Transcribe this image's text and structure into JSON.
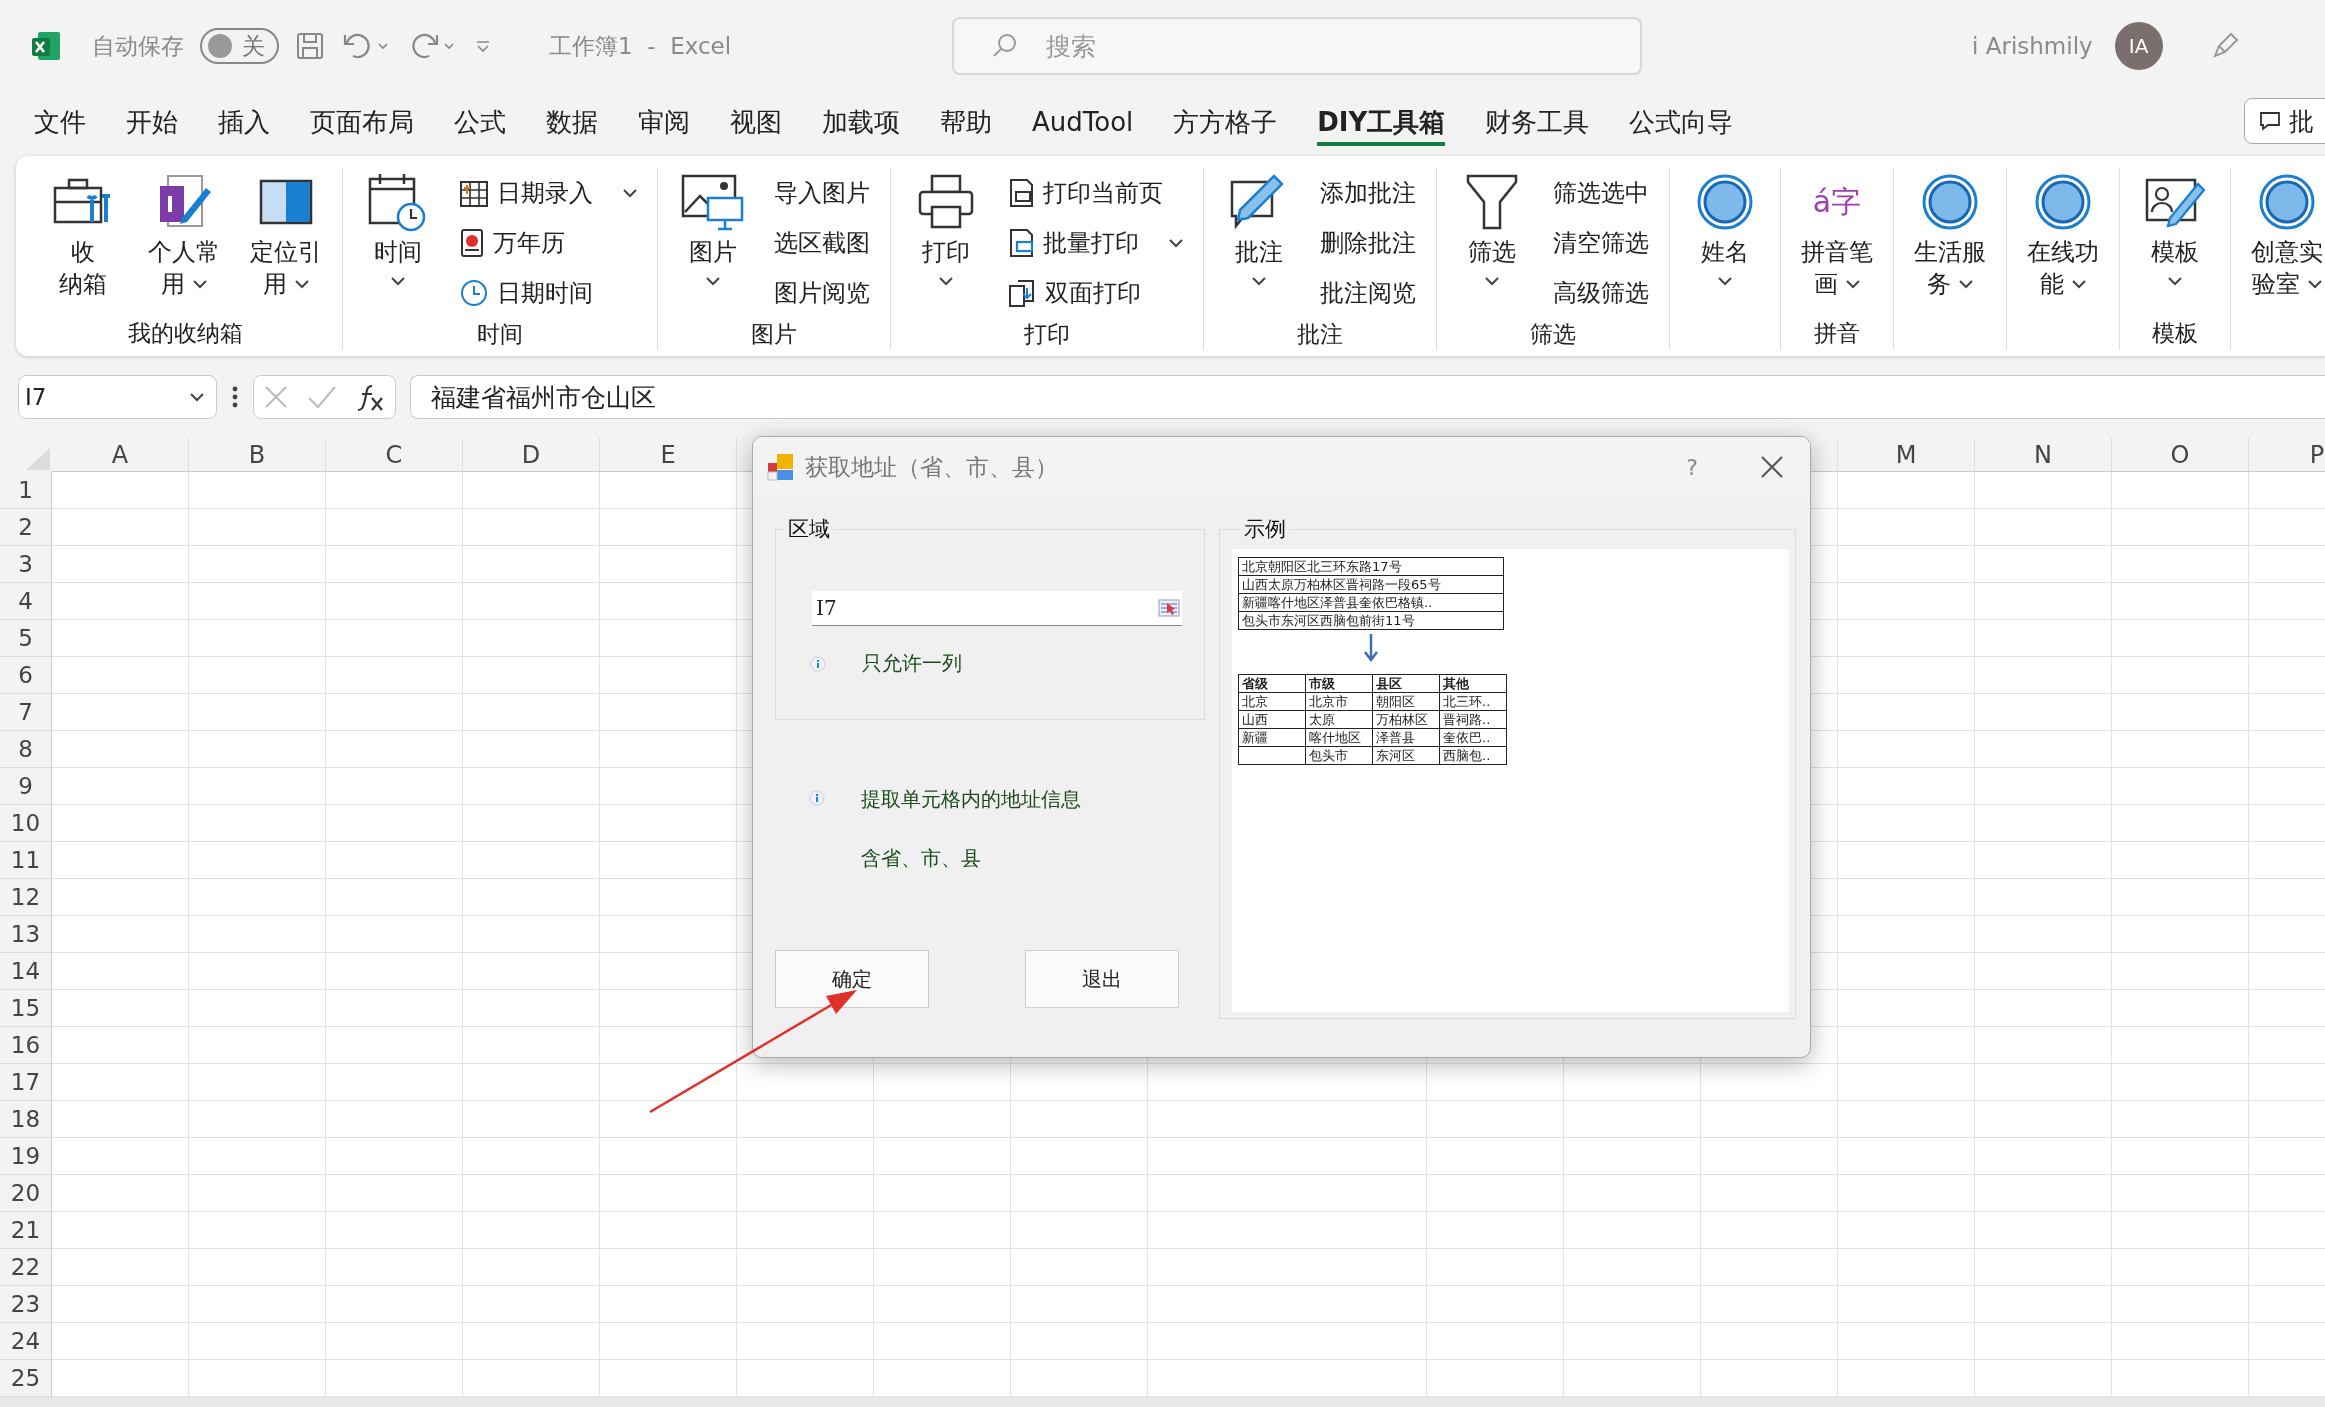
{
  "title_bar": {
    "autosave_label": "自动保存",
    "autosave_toggle": {
      "label": "关",
      "on": false
    },
    "document_title": "工作簿1  -  Excel",
    "search": {
      "placeholder": "搜索"
    },
    "user_name": "i Arishmily",
    "avatar_initials": "IA"
  },
  "ribbon_tabs": [
    {
      "label": "文件",
      "selected": false
    },
    {
      "label": "开始",
      "selected": false
    },
    {
      "label": "插入",
      "selected": false
    },
    {
      "label": "页面布局",
      "selected": false
    },
    {
      "label": "公式",
      "selected": false
    },
    {
      "label": "数据",
      "selected": false
    },
    {
      "label": "审阅",
      "selected": false
    },
    {
      "label": "视图",
      "selected": false
    },
    {
      "label": "加载项",
      "selected": false
    },
    {
      "label": "帮助",
      "selected": false
    },
    {
      "label": "AudTool",
      "selected": false
    },
    {
      "label": "方方格子",
      "selected": false
    },
    {
      "label": "DIY工具箱",
      "selected": true
    },
    {
      "label": "财务工具",
      "selected": false
    },
    {
      "label": "公式向导",
      "selected": false
    }
  ],
  "comment_button": {
    "label": "批"
  },
  "ribbon_groups": [
    {
      "label": "我的收纳箱",
      "controls": [
        {
          "kind": "large",
          "lines": [
            "收",
            "纳箱"
          ],
          "dropdown": false
        },
        {
          "kind": "large",
          "lines": [
            "个人常",
            "用"
          ],
          "dropdown": true
        },
        {
          "kind": "large",
          "lines": [
            "定位引",
            "用"
          ],
          "dropdown": true
        }
      ]
    },
    {
      "label": "时间",
      "controls": [
        {
          "kind": "large",
          "lines": [
            "时间"
          ],
          "dropdown": true
        },
        {
          "kind": "small",
          "lines": [
            "日期录入"
          ],
          "dropdown": true
        },
        {
          "kind": "small",
          "lines": [
            "万年历"
          ],
          "dropdown": false
        },
        {
          "kind": "small",
          "lines": [
            "日期时间"
          ],
          "dropdown": false
        }
      ]
    },
    {
      "label": "图片",
      "controls": [
        {
          "kind": "large",
          "lines": [
            "图片"
          ],
          "dropdown": true
        },
        {
          "kind": "small",
          "lines": [
            "导入图片"
          ],
          "dropdown": false
        },
        {
          "kind": "small",
          "lines": [
            "选区截图"
          ],
          "dropdown": false
        },
        {
          "kind": "small",
          "lines": [
            "图片阅览"
          ],
          "dropdown": false
        }
      ]
    },
    {
      "label": "打印",
      "controls": [
        {
          "kind": "large",
          "lines": [
            "打印"
          ],
          "dropdown": true
        },
        {
          "kind": "small",
          "lines": [
            "打印当前页"
          ],
          "dropdown": false
        },
        {
          "kind": "small",
          "lines": [
            "批量打印"
          ],
          "dropdown": true
        },
        {
          "kind": "small",
          "lines": [
            "双面打印"
          ],
          "dropdown": false
        }
      ]
    },
    {
      "label": "批注",
      "controls": [
        {
          "kind": "large",
          "lines": [
            "批注"
          ],
          "dropdown": true
        },
        {
          "kind": "small",
          "lines": [
            "添加批注"
          ],
          "dropdown": false
        },
        {
          "kind": "small",
          "lines": [
            "删除批注"
          ],
          "dropdown": false
        },
        {
          "kind": "small",
          "lines": [
            "批注阅览"
          ],
          "dropdown": false
        }
      ]
    },
    {
      "label": "筛选",
      "controls": [
        {
          "kind": "large",
          "lines": [
            "筛选"
          ],
          "dropdown": true
        },
        {
          "kind": "small",
          "lines": [
            "筛选选中"
          ],
          "dropdown": false
        },
        {
          "kind": "small",
          "lines": [
            "清空筛选"
          ],
          "dropdown": false
        },
        {
          "kind": "small",
          "lines": [
            "高级筛选"
          ],
          "dropdown": false
        }
      ]
    },
    {
      "controls": [
        {
          "kind": "large",
          "lines": [
            "姓名"
          ],
          "dropdown": true
        }
      ]
    },
    {
      "label": "拼音",
      "controls": [
        {
          "kind": "large",
          "icon_text": "á字",
          "lines": [
            "拼音笔",
            "画"
          ],
          "dropdown": true
        }
      ]
    },
    {
      "controls": [
        {
          "kind": "large",
          "lines": [
            "生活服",
            "务"
          ],
          "dropdown": true
        }
      ]
    },
    {
      "controls": [
        {
          "kind": "large",
          "lines": [
            "在线功",
            "能"
          ],
          "dropdown": true
        }
      ]
    },
    {
      "label": "模板",
      "controls": [
        {
          "kind": "large",
          "lines": [
            "模板"
          ],
          "dropdown": true
        }
      ]
    },
    {
      "controls": [
        {
          "kind": "large",
          "lines": [
            "创意实",
            "验室"
          ],
          "dropdown": true
        }
      ]
    }
  ],
  "formula_bar": {
    "name_box": "I7",
    "formula": "福建省福州市仓山区"
  },
  "column_headers": {
    "left": [
      "A",
      "B",
      "C",
      "D",
      "E"
    ],
    "right": [
      "M",
      "N",
      "O",
      "P"
    ]
  },
  "row_headers": [
    "1",
    "2",
    "3",
    "4",
    "5",
    "6",
    "7",
    "8",
    "9",
    "10",
    "11",
    "12",
    "13",
    "14",
    "15",
    "16",
    "17",
    "18",
    "19",
    "20",
    "21",
    "22",
    "23",
    "24",
    "25"
  ],
  "dialog": {
    "title": "获取地址（省、市、县）",
    "help_button": "?",
    "range_group": {
      "legend": "区域",
      "input_value": "I7",
      "note": "只允许一列"
    },
    "info_lines": [
      "提取单元格内的地址信息",
      "含省、市、县"
    ],
    "buttons": [
      {
        "label": "确定"
      },
      {
        "label": "退出"
      }
    ],
    "example_group": {
      "legend": "示例",
      "addresses": [
        "北京朝阳区北三环东路17号",
        "山西太原万柏林区晋祠路一段65号",
        "新疆喀什地区泽普县奎依巴格镇..",
        "包头市东河区西脑包前街11号"
      ],
      "columns": [
        "省级",
        "市级",
        "县区",
        "其他"
      ],
      "rows": [
        [
          "北京",
          "北京市",
          "朝阳区",
          "北三环.."
        ],
        [
          "山西",
          "太原",
          "万柏林区",
          "晋祠路.."
        ],
        [
          "新疆",
          "喀什地区",
          "泽普县",
          "奎依巴.."
        ],
        [
          null,
          "包头市",
          "东河区",
          "西脑包.."
        ]
      ]
    }
  }
}
